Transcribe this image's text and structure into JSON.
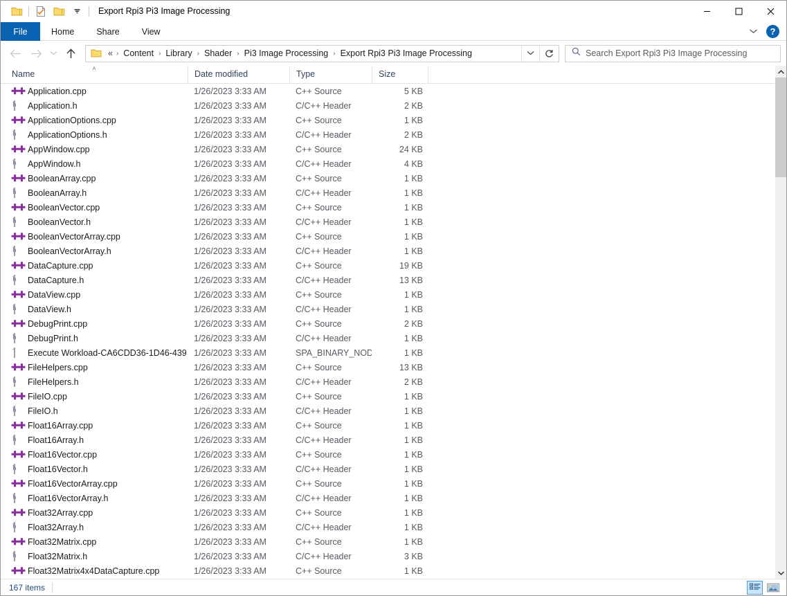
{
  "window": {
    "title": "Export Rpi3 Pi3 Image Processing",
    "controls": {
      "minimize": "—",
      "maximize": "□",
      "close": "✕"
    }
  },
  "quick_access": {
    "items": [
      {
        "name": "folder-icon",
        "label": ""
      },
      {
        "name": "properties-icon",
        "label": ""
      },
      {
        "name": "new-folder-icon",
        "label": ""
      },
      {
        "name": "customize-qat-dropdown-icon",
        "label": "▼"
      }
    ]
  },
  "ribbon": {
    "tabs": [
      {
        "label": "File",
        "active": true
      },
      {
        "label": "Home",
        "active": false
      },
      {
        "label": "Share",
        "active": false
      },
      {
        "label": "View",
        "active": false
      }
    ],
    "expand_icon": "⌄",
    "help_label": "?"
  },
  "nav": {
    "back": "←",
    "forward": "→",
    "recent": "⌄",
    "up": "↑"
  },
  "address": {
    "overflow": "«",
    "crumbs": [
      "Content",
      "Library",
      "Shader",
      "Pi3 Image Processing",
      "Export Rpi3 Pi3 Image Processing"
    ],
    "separator": "›",
    "dropdown_icon": "⌄",
    "refresh_icon": "↻"
  },
  "search": {
    "placeholder": "Search Export Rpi3 Pi3 Image Processing",
    "icon": "search-icon"
  },
  "columns": [
    {
      "key": "name",
      "label": "Name",
      "sorted": "asc"
    },
    {
      "key": "date",
      "label": "Date modified",
      "sorted": ""
    },
    {
      "key": "type",
      "label": "Type",
      "sorted": ""
    },
    {
      "key": "size",
      "label": "Size",
      "sorted": ""
    }
  ],
  "sort_indicator": "˄",
  "files": [
    {
      "name": "Application.cpp",
      "date": "1/26/2023 3:33 AM",
      "type": "C++ Source",
      "size": "5 KB",
      "icon": "cpp"
    },
    {
      "name": "Application.h",
      "date": "1/26/2023 3:33 AM",
      "type": "C/C++ Header",
      "size": "2 KB",
      "icon": "header"
    },
    {
      "name": "ApplicationOptions.cpp",
      "date": "1/26/2023 3:33 AM",
      "type": "C++ Source",
      "size": "1 KB",
      "icon": "cpp"
    },
    {
      "name": "ApplicationOptions.h",
      "date": "1/26/2023 3:33 AM",
      "type": "C/C++ Header",
      "size": "2 KB",
      "icon": "header"
    },
    {
      "name": "AppWindow.cpp",
      "date": "1/26/2023 3:33 AM",
      "type": "C++ Source",
      "size": "24 KB",
      "icon": "cpp"
    },
    {
      "name": "AppWindow.h",
      "date": "1/26/2023 3:33 AM",
      "type": "C/C++ Header",
      "size": "4 KB",
      "icon": "header"
    },
    {
      "name": "BooleanArray.cpp",
      "date": "1/26/2023 3:33 AM",
      "type": "C++ Source",
      "size": "1 KB",
      "icon": "cpp"
    },
    {
      "name": "BooleanArray.h",
      "date": "1/26/2023 3:33 AM",
      "type": "C/C++ Header",
      "size": "1 KB",
      "icon": "header"
    },
    {
      "name": "BooleanVector.cpp",
      "date": "1/26/2023 3:33 AM",
      "type": "C++ Source",
      "size": "1 KB",
      "icon": "cpp"
    },
    {
      "name": "BooleanVector.h",
      "date": "1/26/2023 3:33 AM",
      "type": "C/C++ Header",
      "size": "1 KB",
      "icon": "header"
    },
    {
      "name": "BooleanVectorArray.cpp",
      "date": "1/26/2023 3:33 AM",
      "type": "C++ Source",
      "size": "1 KB",
      "icon": "cpp"
    },
    {
      "name": "BooleanVectorArray.h",
      "date": "1/26/2023 3:33 AM",
      "type": "C/C++ Header",
      "size": "1 KB",
      "icon": "header"
    },
    {
      "name": "DataCapture.cpp",
      "date": "1/26/2023 3:33 AM",
      "type": "C++ Source",
      "size": "19 KB",
      "icon": "cpp"
    },
    {
      "name": "DataCapture.h",
      "date": "1/26/2023 3:33 AM",
      "type": "C/C++ Header",
      "size": "13 KB",
      "icon": "header"
    },
    {
      "name": "DataView.cpp",
      "date": "1/26/2023 3:33 AM",
      "type": "C++ Source",
      "size": "1 KB",
      "icon": "cpp"
    },
    {
      "name": "DataView.h",
      "date": "1/26/2023 3:33 AM",
      "type": "C/C++ Header",
      "size": "1 KB",
      "icon": "header"
    },
    {
      "name": "DebugPrint.cpp",
      "date": "1/26/2023 3:33 AM",
      "type": "C++ Source",
      "size": "2 KB",
      "icon": "cpp"
    },
    {
      "name": "DebugPrint.h",
      "date": "1/26/2023 3:33 AM",
      "type": "C/C++ Header",
      "size": "1 KB",
      "icon": "header"
    },
    {
      "name": "Execute Workload-CA6CDD36-1D46-439…",
      "date": "1/26/2023 3:33 AM",
      "type": "SPA_BINARY_NOD…",
      "size": "1 KB",
      "icon": "blank"
    },
    {
      "name": "FileHelpers.cpp",
      "date": "1/26/2023 3:33 AM",
      "type": "C++ Source",
      "size": "13 KB",
      "icon": "cpp"
    },
    {
      "name": "FileHelpers.h",
      "date": "1/26/2023 3:33 AM",
      "type": "C/C++ Header",
      "size": "2 KB",
      "icon": "header"
    },
    {
      "name": "FileIO.cpp",
      "date": "1/26/2023 3:33 AM",
      "type": "C++ Source",
      "size": "1 KB",
      "icon": "cpp"
    },
    {
      "name": "FileIO.h",
      "date": "1/26/2023 3:33 AM",
      "type": "C/C++ Header",
      "size": "1 KB",
      "icon": "header"
    },
    {
      "name": "Float16Array.cpp",
      "date": "1/26/2023 3:33 AM",
      "type": "C++ Source",
      "size": "1 KB",
      "icon": "cpp"
    },
    {
      "name": "Float16Array.h",
      "date": "1/26/2023 3:33 AM",
      "type": "C/C++ Header",
      "size": "1 KB",
      "icon": "header"
    },
    {
      "name": "Float16Vector.cpp",
      "date": "1/26/2023 3:33 AM",
      "type": "C++ Source",
      "size": "1 KB",
      "icon": "cpp"
    },
    {
      "name": "Float16Vector.h",
      "date": "1/26/2023 3:33 AM",
      "type": "C/C++ Header",
      "size": "1 KB",
      "icon": "header"
    },
    {
      "name": "Float16VectorArray.cpp",
      "date": "1/26/2023 3:33 AM",
      "type": "C++ Source",
      "size": "1 KB",
      "icon": "cpp"
    },
    {
      "name": "Float16VectorArray.h",
      "date": "1/26/2023 3:33 AM",
      "type": "C/C++ Header",
      "size": "1 KB",
      "icon": "header"
    },
    {
      "name": "Float32Array.cpp",
      "date": "1/26/2023 3:33 AM",
      "type": "C++ Source",
      "size": "1 KB",
      "icon": "cpp"
    },
    {
      "name": "Float32Array.h",
      "date": "1/26/2023 3:33 AM",
      "type": "C/C++ Header",
      "size": "1 KB",
      "icon": "header"
    },
    {
      "name": "Float32Matrix.cpp",
      "date": "1/26/2023 3:33 AM",
      "type": "C++ Source",
      "size": "1 KB",
      "icon": "cpp"
    },
    {
      "name": "Float32Matrix.h",
      "date": "1/26/2023 3:33 AM",
      "type": "C/C++ Header",
      "size": "3 KB",
      "icon": "header"
    },
    {
      "name": "Float32Matrix4x4DataCapture.cpp",
      "date": "1/26/2023 3:33 AM",
      "type": "C++ Source",
      "size": "1 KB",
      "icon": "cpp"
    }
  ],
  "scrollbar": {
    "up_arrow": "˄",
    "down_arrow": "˅"
  },
  "status": {
    "item_count": "167 items"
  },
  "view_buttons": [
    {
      "name": "details-view-button",
      "active": true
    },
    {
      "name": "large-icons-view-button",
      "active": false
    }
  ],
  "colors": {
    "accent": "#0a62b0",
    "cpp_icon": "#8a2f9e",
    "header_text": "#32455e",
    "status_text": "#1b4a7a",
    "scroll_thumb": "#cdcdcd",
    "view_active_bg": "#cce4f7"
  }
}
